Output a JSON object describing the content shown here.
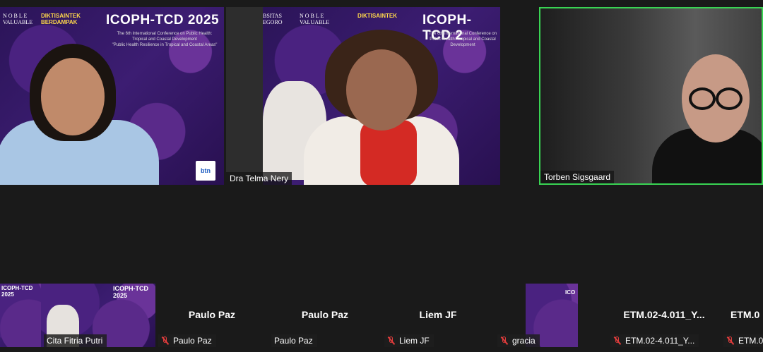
{
  "conference": {
    "title": "ICOPH-TCD 2025",
    "title_short": "ICOPH-TCD 2",
    "subtitle": "The 6th International Conference on Public Health: Tropical and Coastal Development",
    "theme": "\"Public Health Resilience in Tropical and Coastal Areas\"",
    "logo_text_1": "N O B L E",
    "logo_text_2": "VALUABLE",
    "diktisaintek_1": "DIKTISAINTEK",
    "diktisaintek_2": "BERDAMPAK",
    "universitas_1": "BSITAS",
    "universitas_2": "EGORO",
    "btn_logo": "btn"
  },
  "video_tiles": [
    {
      "name": ""
    },
    {
      "name": "Dra Telma Nery"
    },
    {
      "name": "Torben Sigsgaard",
      "active_speaker": true
    }
  ],
  "thumbnails": [
    {
      "display_name": "",
      "label": "",
      "muted": false
    },
    {
      "display_name": "",
      "label": "Cita Fitria Putri",
      "muted": false
    },
    {
      "display_name": "Paulo Paz",
      "label": "Paulo Paz",
      "muted": true
    },
    {
      "display_name": "Paulo Paz",
      "label": "Paulo Paz",
      "muted": false
    },
    {
      "display_name": "Liem JF",
      "label": "Liem JF",
      "muted": true
    },
    {
      "display_name": "",
      "label": "gracia",
      "muted": true
    },
    {
      "display_name": "ETM.02-4.011_Y...",
      "label": "ETM.02-4.011_Y...",
      "muted": true
    },
    {
      "display_name": "ETM.0",
      "label": "ETM.0",
      "muted": true
    }
  ],
  "colors": {
    "active_speaker_border": "#39d353",
    "muted_icon": "#e03c3c"
  }
}
